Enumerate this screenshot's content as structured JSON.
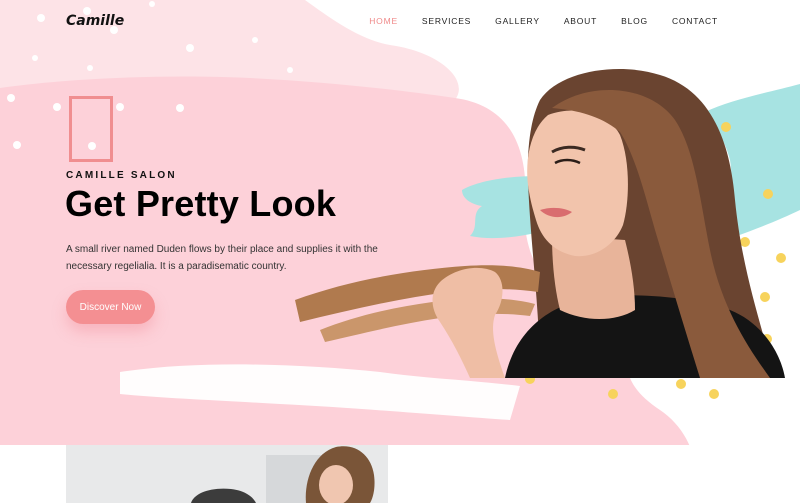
{
  "brand": {
    "name": "Camille"
  },
  "nav": {
    "items": [
      {
        "label": "HOME",
        "active": true
      },
      {
        "label": "SERVICES",
        "active": false
      },
      {
        "label": "GALLERY",
        "active": false
      },
      {
        "label": "ABOUT",
        "active": false
      },
      {
        "label": "BLOG",
        "active": false
      },
      {
        "label": "CONTACT",
        "active": false
      }
    ]
  },
  "hero": {
    "kicker": "CAMILLE SALON",
    "title": "Get Pretty Look",
    "description": "A small river named Duden flows by their place and supplies it with the necessary regelialia. It is a paradisematic country.",
    "cta_label": "Discover Now"
  },
  "colors": {
    "accent": "#f08a8a",
    "pink_bg": "#fdd3da",
    "teal": "#a9e4e3",
    "yellow_dot": "#f7d35c"
  }
}
